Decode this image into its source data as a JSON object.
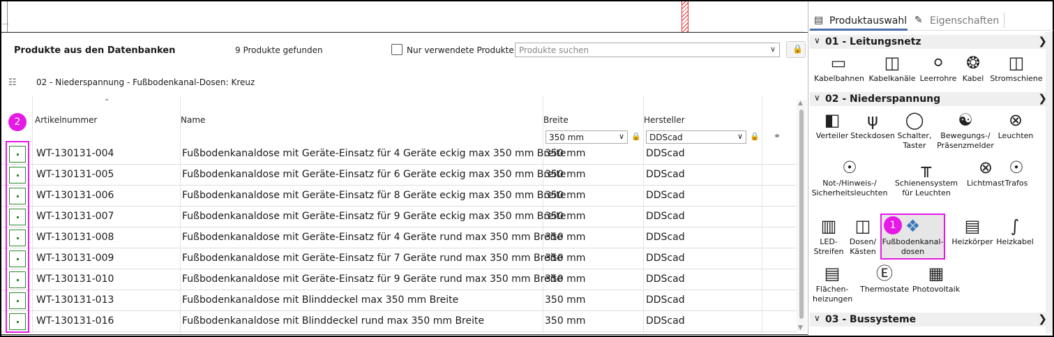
{
  "top_strip": {
    "dots": "..."
  },
  "dialog": {
    "title": "Produkte aus den Datenbanken",
    "count": "9 Produkte gefunden",
    "only_used_label": "Nur verwendete Produkte",
    "search_placeholder": "Produkte suchen",
    "breadcrumb": "02 - Niederspannung - Fußbodenkanal-Dosen: Kreuz",
    "columns": {
      "art": "Artikelnummer",
      "name": "Name",
      "breite": "Breite",
      "hersteller": "Hersteller"
    },
    "filters": {
      "breite": "350 mm",
      "hersteller": "DDScad"
    },
    "badge_2": "2",
    "rows": [
      {
        "art": "WT-130131-004",
        "name": "Fußbodenkanaldose mit Geräte-Einsatz für 4 Geräte eckig max 350 mm Breite",
        "breite": "350 mm",
        "hersteller": "DDScad"
      },
      {
        "art": "WT-130131-005",
        "name": "Fußbodenkanaldose mit Geräte-Einsatz für 6 Geräte eckig max 350 mm Breite",
        "breite": "350 mm",
        "hersteller": "DDScad"
      },
      {
        "art": "WT-130131-006",
        "name": "Fußbodenkanaldose mit Geräte-Einsatz für 8 Geräte eckig max 350 mm Breite",
        "breite": "350 mm",
        "hersteller": "DDScad"
      },
      {
        "art": "WT-130131-007",
        "name": "Fußbodenkanaldose mit Geräte-Einsatz für 9 Geräte eckig max 350 mm Breite",
        "breite": "350 mm",
        "hersteller": "DDScad"
      },
      {
        "art": "WT-130131-008",
        "name": "Fußbodenkanaldose mit Geräte-Einsatz für 4 Geräte rund max 350 mm Breite",
        "breite": "350 mm",
        "hersteller": "DDScad"
      },
      {
        "art": "WT-130131-009",
        "name": "Fußbodenkanaldose mit Geräte-Einsatz für 7 Geräte rund max 350 mm Breite",
        "breite": "350 mm",
        "hersteller": "DDScad"
      },
      {
        "art": "WT-130131-010",
        "name": "Fußbodenkanaldose mit Geräte-Einsatz für 9 Geräte rund max 350 mm Breite",
        "breite": "350 mm",
        "hersteller": "DDScad"
      },
      {
        "art": "WT-130131-013",
        "name": "Fußbodenkanaldose mit Blinddeckel max 350 mm Breite",
        "breite": "350 mm",
        "hersteller": "DDScad"
      },
      {
        "art": "WT-130131-016",
        "name": "Fußbodenkanaldose mit Blinddeckel rund max 350 mm Breite",
        "breite": "350 mm",
        "hersteller": "DDScad"
      }
    ]
  },
  "panel": {
    "tab1": "Produktauswahl",
    "tab2": "Eigenschaften",
    "badge_1": "1",
    "sec1": "01 - Leitungsnetz",
    "sec2": "02 - Niederspannung",
    "sec3": "03 - Bussysteme",
    "leitungsnetz": [
      "Kabelbahnen",
      "Kabelkanäle",
      "Leerrohre",
      "Kabel",
      "Stromschiene"
    ],
    "ns": {
      "verteiler": "Verteiler",
      "steckdosen": "Steckdosen",
      "schalter1": "Schalter,",
      "schalter2": "Taster",
      "bewegung1": "Bewegungs-/",
      "bewegung2": "Präsenzmelder",
      "leuchten": "Leuchten",
      "not1": "Not-/Hinweis-/",
      "not2": "Sicherheitsleuchten",
      "schiene1": "Schienensystem",
      "schiene2": "für Leuchten",
      "lichtmast": "Lichtmast",
      "trafos": "Trafos",
      "led1": "LED-",
      "led2": "Streifen",
      "dosen1": "Dosen/",
      "dosen2": "Kästen",
      "fbk1": "Fußbodenkanal-",
      "fbk2": "dosen",
      "heizkoerper": "Heizkörper",
      "heizkabel": "Heizkabel",
      "flaechen1": "Flächen-",
      "flaechen2": "heizungen",
      "thermostate": "Thermostate",
      "pv": "Photovoltaik"
    }
  }
}
